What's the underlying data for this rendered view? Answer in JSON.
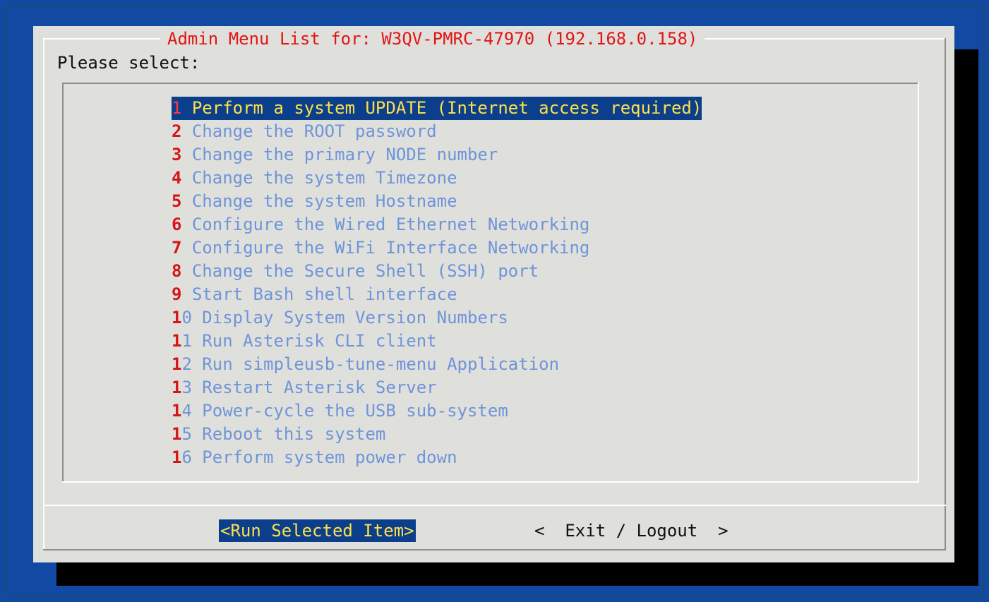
{
  "dialog": {
    "title": "Admin Menu List for: W3QV-PMRC-47970 (192.168.0.158)",
    "prompt": "Please select:"
  },
  "menu": {
    "selected_index": 0,
    "items": [
      {
        "number": "1",
        "label": "Perform a system UPDATE (Internet access required)"
      },
      {
        "number": "2",
        "label": "Change the ROOT password"
      },
      {
        "number": "3",
        "label": "Change the primary NODE number"
      },
      {
        "number": "4",
        "label": "Change the system Timezone"
      },
      {
        "number": "5",
        "label": "Change the system Hostname"
      },
      {
        "number": "6",
        "label": "Configure the Wired Ethernet Networking"
      },
      {
        "number": "7",
        "label": "Configure the WiFi Interface Networking"
      },
      {
        "number": "8",
        "label": "Change the Secure Shell (SSH) port"
      },
      {
        "number": "9",
        "label": "Start Bash shell interface"
      },
      {
        "number": "10",
        "label": "Display System Version Numbers"
      },
      {
        "number": "11",
        "label": "Run Asterisk CLI client"
      },
      {
        "number": "12",
        "label": "Run simpleusb-tune-menu Application"
      },
      {
        "number": "13",
        "label": "Restart Asterisk Server"
      },
      {
        "number": "14",
        "label": "Power-cycle the USB sub-system"
      },
      {
        "number": "15",
        "label": "Reboot this system"
      },
      {
        "number": "16",
        "label": "Perform system power down"
      }
    ]
  },
  "buttons": {
    "run_label": "<Run Selected Item>",
    "exit_label": "<  Exit / Logout  >"
  },
  "colors": {
    "background": "#1249a3",
    "dialog": "#dfe0dc",
    "title": "#e11515",
    "menu_text": "#6f94d9",
    "hotkey": "#d61616",
    "selection_bg": "#0b3f8c",
    "selection_text": "#ffe04a"
  }
}
